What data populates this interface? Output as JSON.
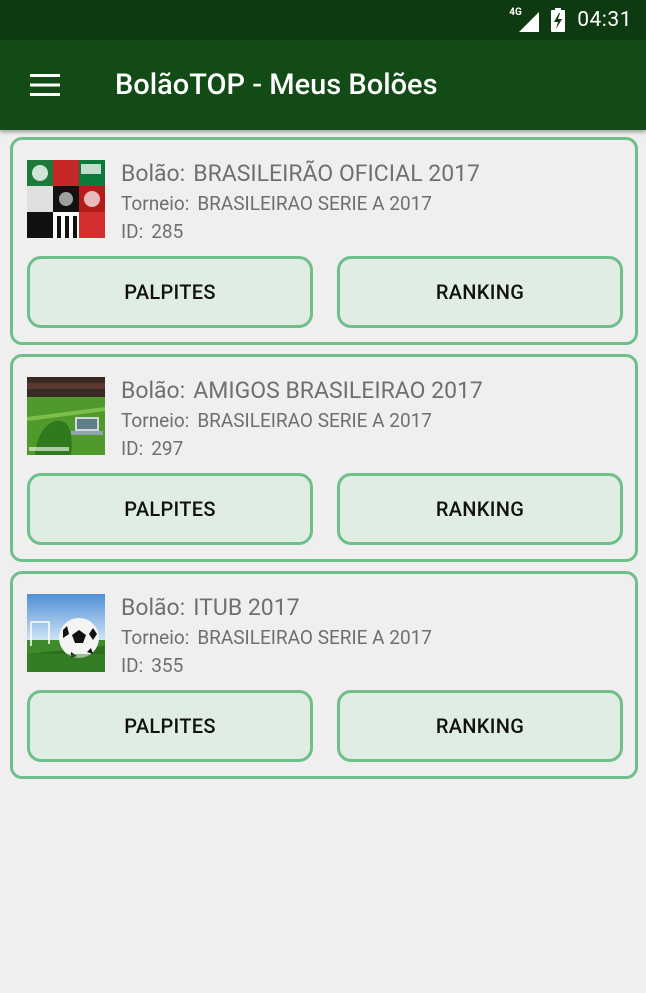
{
  "status_bar": {
    "network": "4G",
    "time": "04:31",
    "icons": [
      "signal-icon",
      "battery-charging-icon"
    ]
  },
  "app_bar": {
    "title": "BolãoTOP - Meus Bolões",
    "menu_icon": "menu-icon"
  },
  "labels": {
    "bolao": "Bolão:",
    "torneio": "Torneio:",
    "id": "ID:",
    "palpites": "PALPITES",
    "ranking": "RANKING"
  },
  "boloes": [
    {
      "name": "BRASILEIRÃO OFICIAL 2017",
      "torneio": "BRASILEIRAO SERIE A 2017",
      "id": "285",
      "image": "team-logos-collage"
    },
    {
      "name": "AMIGOS BRASILEIRAO 2017",
      "torneio": "BRASILEIRAO SERIE A 2017",
      "id": "297",
      "image": "stadium-grass-laptop"
    },
    {
      "name": "ITUB 2017",
      "torneio": "BRASILEIRAO SERIE A 2017",
      "id": "355",
      "image": "soccer-ball-field"
    }
  ],
  "colors": {
    "status_bar": "#0d3a11",
    "app_bar": "#124b15",
    "card_border": "#6fbf8a",
    "button_fill": "#e0ede2",
    "background": "#efefef"
  }
}
